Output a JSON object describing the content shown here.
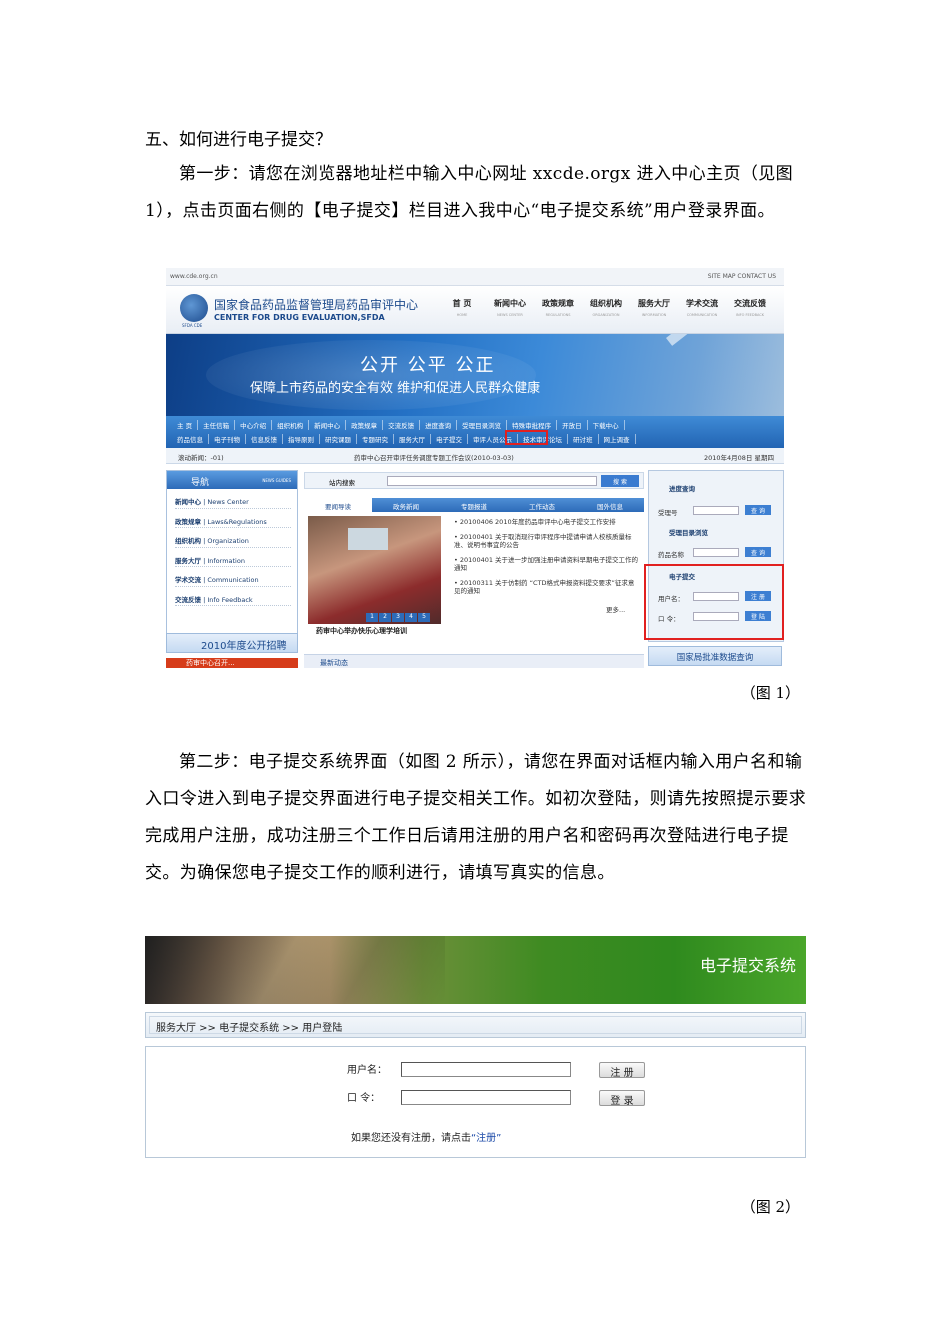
{
  "doc": {
    "heading": "五、如何进行电子提交？",
    "para1": "第一步：请您在浏览器地址栏中输入中心网址 xxcde.orgx 进入中心主页（见图 1），点击页面右侧的【电子提交】栏目进入我中心“电子提交系统”用户登录界面。",
    "caption1": "（图 1）",
    "para2": "第二步：电子提交系统界面（如图 2 所示），请您在界面对话框内输入用户名和输入口令进入到电子提交界面进行电子提交相关工作。如初次登陆，则请先按照提示要求完成用户注册，成功注册三个工作日后请用注册的用户名和密码再次登陆进行电子提交。为确保您电子提交工作的顺利进行，请填写真实的信息。",
    "caption2": "（图 2）"
  },
  "fig1": {
    "url": "www.cde.org.cn",
    "top_links": "SITE MAP   CONTACT US",
    "logo_text": "SFDA CDE",
    "title_cn": "国家食品药品监督管理局药品审评中心",
    "title_en": "CENTER FOR DRUG EVALUATION,SFDA",
    "nav": [
      {
        "cn": "首 页",
        "en": "HOME"
      },
      {
        "cn": "新闻中心",
        "en": "NEWS CENTER"
      },
      {
        "cn": "政策规章",
        "en": "REGULATIONS"
      },
      {
        "cn": "组织机构",
        "en": "ORGANIZATION"
      },
      {
        "cn": "服务大厅",
        "en": "INFORMATION"
      },
      {
        "cn": "学术交流",
        "en": "COMMUNICATION"
      },
      {
        "cn": "交流反馈",
        "en": "INFO FEEDBACK"
      }
    ],
    "slogan1": "公开  公平  公正",
    "slogan2": "保障上市药品的安全有效    维护和促进人民群众健康",
    "menu_row1": [
      "主 页",
      "主任信箱",
      "中心介绍",
      "组织机构",
      "新闻中心",
      "政策规章",
      "交流反馈",
      "进度查询",
      "受理目录浏览",
      "特殊审批程序",
      "开放日",
      "下载中心"
    ],
    "menu_row2": [
      "药品信息",
      "电子刊物",
      "信息反馈",
      "指导原则",
      "研究课题",
      "专题研究",
      "服务大厅",
      "电子提交",
      "审评人员公示",
      "技术审评论坛",
      "研讨班",
      "网上调查"
    ],
    "news_label": "滚动新闻：-01)",
    "news_text": "药审中心召开审评任务调度专题工作会议(2010-03-03)",
    "date": "2010年4月08日  星期四",
    "left_title": "导航",
    "left_title_en": "NEWS GUIDES",
    "left_items": [
      {
        "cn": "新闻中心",
        "en": "| News Center"
      },
      {
        "cn": "政策规章",
        "en": "| Laws&Regulations"
      },
      {
        "cn": "组织机构",
        "en": "| Organization"
      },
      {
        "cn": "服务大厅",
        "en": "| Information"
      },
      {
        "cn": "学术交流",
        "en": "| Communication"
      },
      {
        "cn": "交流反馈",
        "en": "| Info Feedback"
      }
    ],
    "recruit": "2010年度公开招聘",
    "red_bar": "  药审中心召开...",
    "search_label": "站内搜索",
    "search_btn": "搜 索",
    "tabs": [
      "要闻导读",
      "政务新闻",
      "专题报道",
      "工作动态",
      "国外信息"
    ],
    "photo_nums": [
      "1",
      "2",
      "3",
      "4",
      "5"
    ],
    "photo_caption": "药审中心举办快乐心理学培训",
    "news": [
      "• 20100406  2010年度药品审评中心电子提交工作安排",
      "• 20100401  关于取消现行审评程序中提请申请人校核质量标准、说明书事宜的公告",
      "• 20100401  关于进一步加强注册申请资料早期电子提交工作的通知",
      "• 20100311  关于仿制药 “CTD格式申报资料提交要求”征求意见的通知"
    ],
    "more": "更多...",
    "latest": "最新动态",
    "right": {
      "sec1": "进度查询",
      "lbl1": "受理号",
      "btn_query": "查 询",
      "sec2": "受理目录浏览",
      "lbl2": "药品名称",
      "sec3": "电子提交",
      "user_lbl": "用户名：",
      "pass_lbl": "口  令：",
      "btn_reg": "注 册",
      "btn_login": "登 陆"
    },
    "db_btn": "国家局批准数据查询"
  },
  "fig2": {
    "title": "电子提交系统",
    "breadcrumb": "服务大厅 >> 电子提交系统 >> 用户登陆",
    "user_label": "用户名：",
    "pass_label": "口    令：",
    "register_btn": "注 册",
    "login_btn": "登 录",
    "note_prefix": "如果您还没有注册，请点击",
    "note_link": "“注册”"
  },
  "colors": {
    "accent_blue": "#2264b3",
    "highlight_red": "#e12020",
    "banner_green": "#2f8a1e"
  }
}
